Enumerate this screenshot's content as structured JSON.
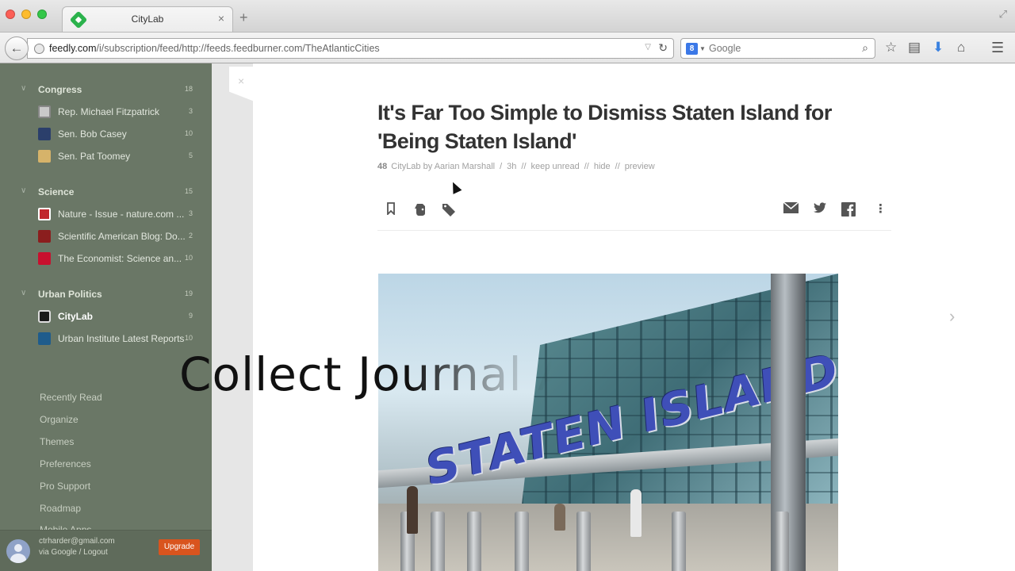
{
  "browser": {
    "tab_title": "CityLab",
    "tab_close": "×",
    "new_tab": "+",
    "url_host": "feedly.com",
    "url_path": "/i/subscription/feed/http://feeds.feedburner.com/TheAtlanticCities",
    "search_placeholder": "Google",
    "search_engine_letter": "8",
    "icons": [
      "back-arrow-icon",
      "globe-icon",
      "reload-icon",
      "search-icon",
      "star-icon",
      "clipboard-icon",
      "download-icon",
      "home-icon",
      "menu-icon"
    ],
    "download_color": "#3b82e0"
  },
  "sidebar": {
    "background": "#6a7766",
    "groups": [
      {
        "name": "Congress",
        "count": "18",
        "feeds": [
          {
            "name": "Rep. Michael Fitzpatrick",
            "count": "3",
            "icon_color": "#c9c9c9"
          },
          {
            "name": "Sen. Bob Casey",
            "count": "10",
            "icon_color": "#2b3f6b"
          },
          {
            "name": "Sen. Pat Toomey",
            "count": "5",
            "icon_color": "#d6b36a"
          }
        ]
      },
      {
        "name": "Science",
        "count": "15",
        "feeds": [
          {
            "name": "Nature - Issue - nature.com ...",
            "count": "3",
            "icon_color": "#c1272d"
          },
          {
            "name": "Scientific American Blog: Do...",
            "count": "2",
            "icon_color": "#8b1e1e"
          },
          {
            "name": "The Economist: Science an...",
            "count": "10",
            "icon_color": "#c8102e"
          }
        ]
      },
      {
        "name": "Urban Politics",
        "count": "19",
        "feeds": [
          {
            "name": "CityLab",
            "count": "9",
            "icon_color": "#1a1a1a",
            "active": true
          },
          {
            "name": "Urban Institute Latest Reports",
            "count": "10",
            "icon_color": "#1f5c8c"
          }
        ]
      }
    ],
    "links": [
      "Recently Read",
      "Organize",
      "Themes",
      "Preferences",
      "Pro Support",
      "Roadmap",
      "Mobile Apps"
    ],
    "account": {
      "email": "ctrharder@gmail.com",
      "logout": "via Google / Logout",
      "upgrade": "Upgrade",
      "upgrade_color": "#d9541e"
    }
  },
  "article": {
    "title": "It's Far Too Simple to Dismiss Staten Island for 'Being Staten Island'",
    "count": "48",
    "source": "CityLab",
    "by": "by",
    "author": "Aarian Marshall",
    "age": "3h",
    "keep_unread": "keep unread",
    "hide": "hide",
    "preview": "preview",
    "separator_slash": "/",
    "separator_double": "//",
    "action_icons": [
      "bookmark-icon",
      "evernote-icon",
      "tag-icon",
      "email-icon",
      "twitter-icon",
      "facebook-icon",
      "more-icon"
    ],
    "hero_sign_text": "STATEN ISLAND"
  },
  "overlay": {
    "caption": "Collect Journal A"
  },
  "next_arrow": "›",
  "gutter_close": "×"
}
